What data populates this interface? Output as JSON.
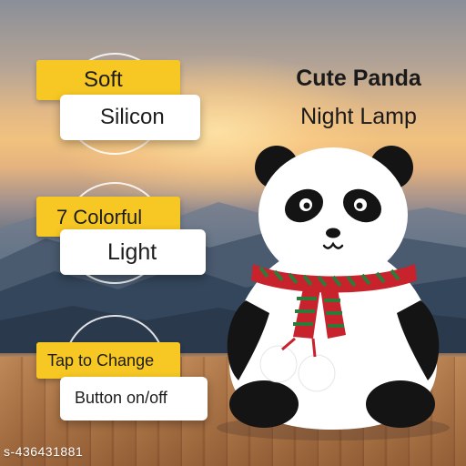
{
  "features": {
    "soft": {
      "line1": "Soft",
      "line2": "Silicon"
    },
    "colorful": {
      "line1": "7 Colorful",
      "line2": "Light"
    },
    "tap": {
      "line1": "Tap to Change",
      "line2": "Button on/off"
    }
  },
  "title": {
    "line1": "Cute Panda",
    "line2": "Night Lamp"
  },
  "watermark": "s-436431881",
  "colors": {
    "accent_yellow": "#f7c824",
    "scarf_red": "#c8232c",
    "scarf_green": "#2f7a3a"
  }
}
